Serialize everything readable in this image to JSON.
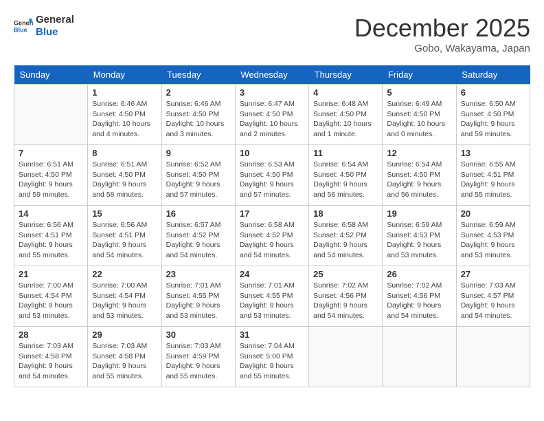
{
  "logo": {
    "line1": "General",
    "line2": "Blue"
  },
  "title": "December 2025",
  "subtitle": "Gobo, Wakayama, Japan",
  "days_header": [
    "Sunday",
    "Monday",
    "Tuesday",
    "Wednesday",
    "Thursday",
    "Friday",
    "Saturday"
  ],
  "weeks": [
    [
      {
        "day": "",
        "info": ""
      },
      {
        "day": "1",
        "info": "Sunrise: 6:46 AM\nSunset: 4:50 PM\nDaylight: 10 hours\nand 4 minutes."
      },
      {
        "day": "2",
        "info": "Sunrise: 6:46 AM\nSunset: 4:50 PM\nDaylight: 10 hours\nand 3 minutes."
      },
      {
        "day": "3",
        "info": "Sunrise: 6:47 AM\nSunset: 4:50 PM\nDaylight: 10 hours\nand 2 minutes."
      },
      {
        "day": "4",
        "info": "Sunrise: 6:48 AM\nSunset: 4:50 PM\nDaylight: 10 hours\nand 1 minute."
      },
      {
        "day": "5",
        "info": "Sunrise: 6:49 AM\nSunset: 4:50 PM\nDaylight: 10 hours\nand 0 minutes."
      },
      {
        "day": "6",
        "info": "Sunrise: 6:50 AM\nSunset: 4:50 PM\nDaylight: 9 hours\nand 59 minutes."
      }
    ],
    [
      {
        "day": "7",
        "info": "Sunrise: 6:51 AM\nSunset: 4:50 PM\nDaylight: 9 hours\nand 59 minutes."
      },
      {
        "day": "8",
        "info": "Sunrise: 6:51 AM\nSunset: 4:50 PM\nDaylight: 9 hours\nand 58 minutes."
      },
      {
        "day": "9",
        "info": "Sunrise: 6:52 AM\nSunset: 4:50 PM\nDaylight: 9 hours\nand 57 minutes."
      },
      {
        "day": "10",
        "info": "Sunrise: 6:53 AM\nSunset: 4:50 PM\nDaylight: 9 hours\nand 57 minutes."
      },
      {
        "day": "11",
        "info": "Sunrise: 6:54 AM\nSunset: 4:50 PM\nDaylight: 9 hours\nand 56 minutes."
      },
      {
        "day": "12",
        "info": "Sunrise: 6:54 AM\nSunset: 4:50 PM\nDaylight: 9 hours\nand 56 minutes."
      },
      {
        "day": "13",
        "info": "Sunrise: 6:55 AM\nSunset: 4:51 PM\nDaylight: 9 hours\nand 55 minutes."
      }
    ],
    [
      {
        "day": "14",
        "info": "Sunrise: 6:56 AM\nSunset: 4:51 PM\nDaylight: 9 hours\nand 55 minutes."
      },
      {
        "day": "15",
        "info": "Sunrise: 6:56 AM\nSunset: 4:51 PM\nDaylight: 9 hours\nand 54 minutes."
      },
      {
        "day": "16",
        "info": "Sunrise: 6:57 AM\nSunset: 4:52 PM\nDaylight: 9 hours\nand 54 minutes."
      },
      {
        "day": "17",
        "info": "Sunrise: 6:58 AM\nSunset: 4:52 PM\nDaylight: 9 hours\nand 54 minutes."
      },
      {
        "day": "18",
        "info": "Sunrise: 6:58 AM\nSunset: 4:52 PM\nDaylight: 9 hours\nand 54 minutes."
      },
      {
        "day": "19",
        "info": "Sunrise: 6:59 AM\nSunset: 4:53 PM\nDaylight: 9 hours\nand 53 minutes."
      },
      {
        "day": "20",
        "info": "Sunrise: 6:59 AM\nSunset: 4:53 PM\nDaylight: 9 hours\nand 53 minutes."
      }
    ],
    [
      {
        "day": "21",
        "info": "Sunrise: 7:00 AM\nSunset: 4:54 PM\nDaylight: 9 hours\nand 53 minutes."
      },
      {
        "day": "22",
        "info": "Sunrise: 7:00 AM\nSunset: 4:54 PM\nDaylight: 9 hours\nand 53 minutes."
      },
      {
        "day": "23",
        "info": "Sunrise: 7:01 AM\nSunset: 4:55 PM\nDaylight: 9 hours\nand 53 minutes."
      },
      {
        "day": "24",
        "info": "Sunrise: 7:01 AM\nSunset: 4:55 PM\nDaylight: 9 hours\nand 53 minutes."
      },
      {
        "day": "25",
        "info": "Sunrise: 7:02 AM\nSunset: 4:56 PM\nDaylight: 9 hours\nand 54 minutes."
      },
      {
        "day": "26",
        "info": "Sunrise: 7:02 AM\nSunset: 4:56 PM\nDaylight: 9 hours\nand 54 minutes."
      },
      {
        "day": "27",
        "info": "Sunrise: 7:03 AM\nSunset: 4:57 PM\nDaylight: 9 hours\nand 54 minutes."
      }
    ],
    [
      {
        "day": "28",
        "info": "Sunrise: 7:03 AM\nSunset: 4:58 PM\nDaylight: 9 hours\nand 54 minutes."
      },
      {
        "day": "29",
        "info": "Sunrise: 7:03 AM\nSunset: 4:58 PM\nDaylight: 9 hours\nand 55 minutes."
      },
      {
        "day": "30",
        "info": "Sunrise: 7:03 AM\nSunset: 4:59 PM\nDaylight: 9 hours\nand 55 minutes."
      },
      {
        "day": "31",
        "info": "Sunrise: 7:04 AM\nSunset: 5:00 PM\nDaylight: 9 hours\nand 55 minutes."
      },
      {
        "day": "",
        "info": ""
      },
      {
        "day": "",
        "info": ""
      },
      {
        "day": "",
        "info": ""
      }
    ]
  ]
}
